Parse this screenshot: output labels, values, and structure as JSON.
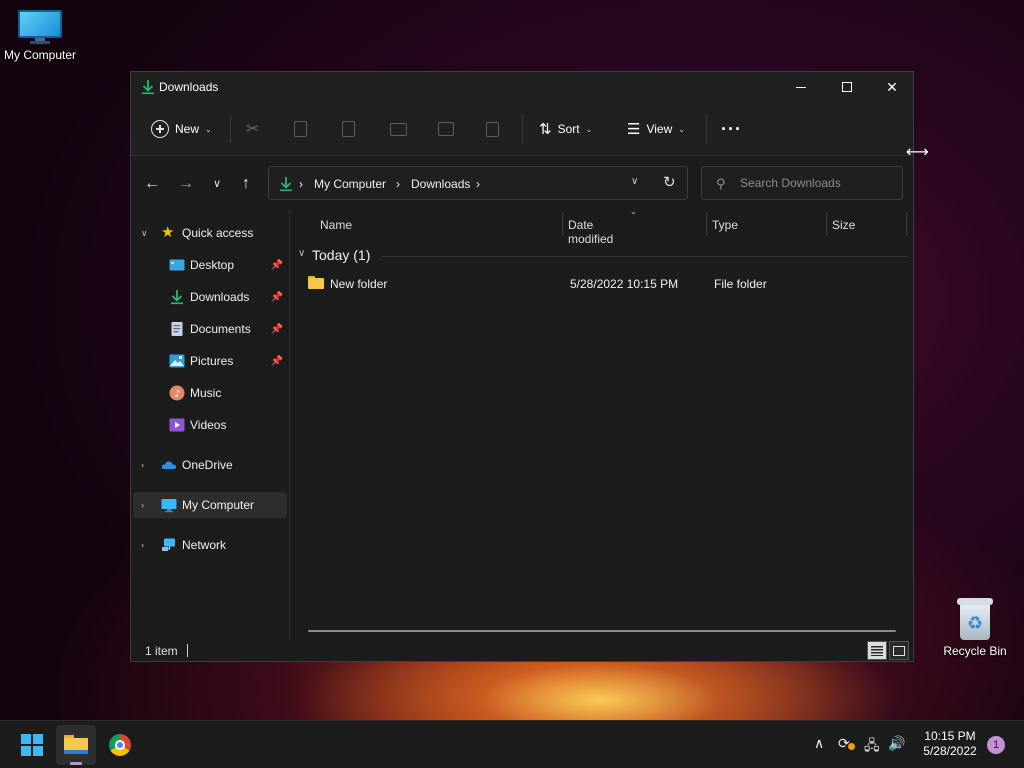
{
  "desktop": {
    "icons": [
      {
        "label": "My Computer",
        "icon": "computer-icon"
      },
      {
        "label": "Recycle Bin",
        "icon": "recycle-bin-icon"
      }
    ]
  },
  "window": {
    "title": "Downloads",
    "controls": {
      "minimize": "minimize",
      "maximize": "maximize",
      "close": "close"
    }
  },
  "toolbar": {
    "new_label": "New",
    "sort_label": "Sort",
    "view_label": "View",
    "disabled_actions": [
      "cut",
      "copy",
      "paste",
      "rename",
      "share",
      "delete"
    ]
  },
  "address": {
    "crumbs": [
      "My Computer",
      "Downloads"
    ],
    "sep": "›"
  },
  "search": {
    "placeholder": "Search Downloads"
  },
  "nav": {
    "quick_access": "Quick access",
    "items": [
      {
        "label": "Desktop",
        "pinned": true
      },
      {
        "label": "Downloads",
        "pinned": true
      },
      {
        "label": "Documents",
        "pinned": true
      },
      {
        "label": "Pictures",
        "pinned": true
      },
      {
        "label": "Music",
        "pinned": false
      },
      {
        "label": "Videos",
        "pinned": false
      }
    ],
    "onedrive": "OneDrive",
    "mycomputer": "My Computer",
    "network": "Network"
  },
  "list": {
    "columns": [
      "Name",
      "Date modified",
      "Type",
      "Size"
    ],
    "group": "Today (1)",
    "rows": [
      {
        "name": "New folder",
        "date": "5/28/2022 10:15 PM",
        "type": "File folder",
        "size": ""
      }
    ]
  },
  "status": {
    "count": "1 item"
  },
  "taskbar": {
    "time": "10:15 PM",
    "date": "5/28/2022",
    "notifications": "1"
  },
  "colors": {
    "accent": "#3ab8f7",
    "download_green": "#2bb673",
    "folder": "#f5c84a"
  }
}
